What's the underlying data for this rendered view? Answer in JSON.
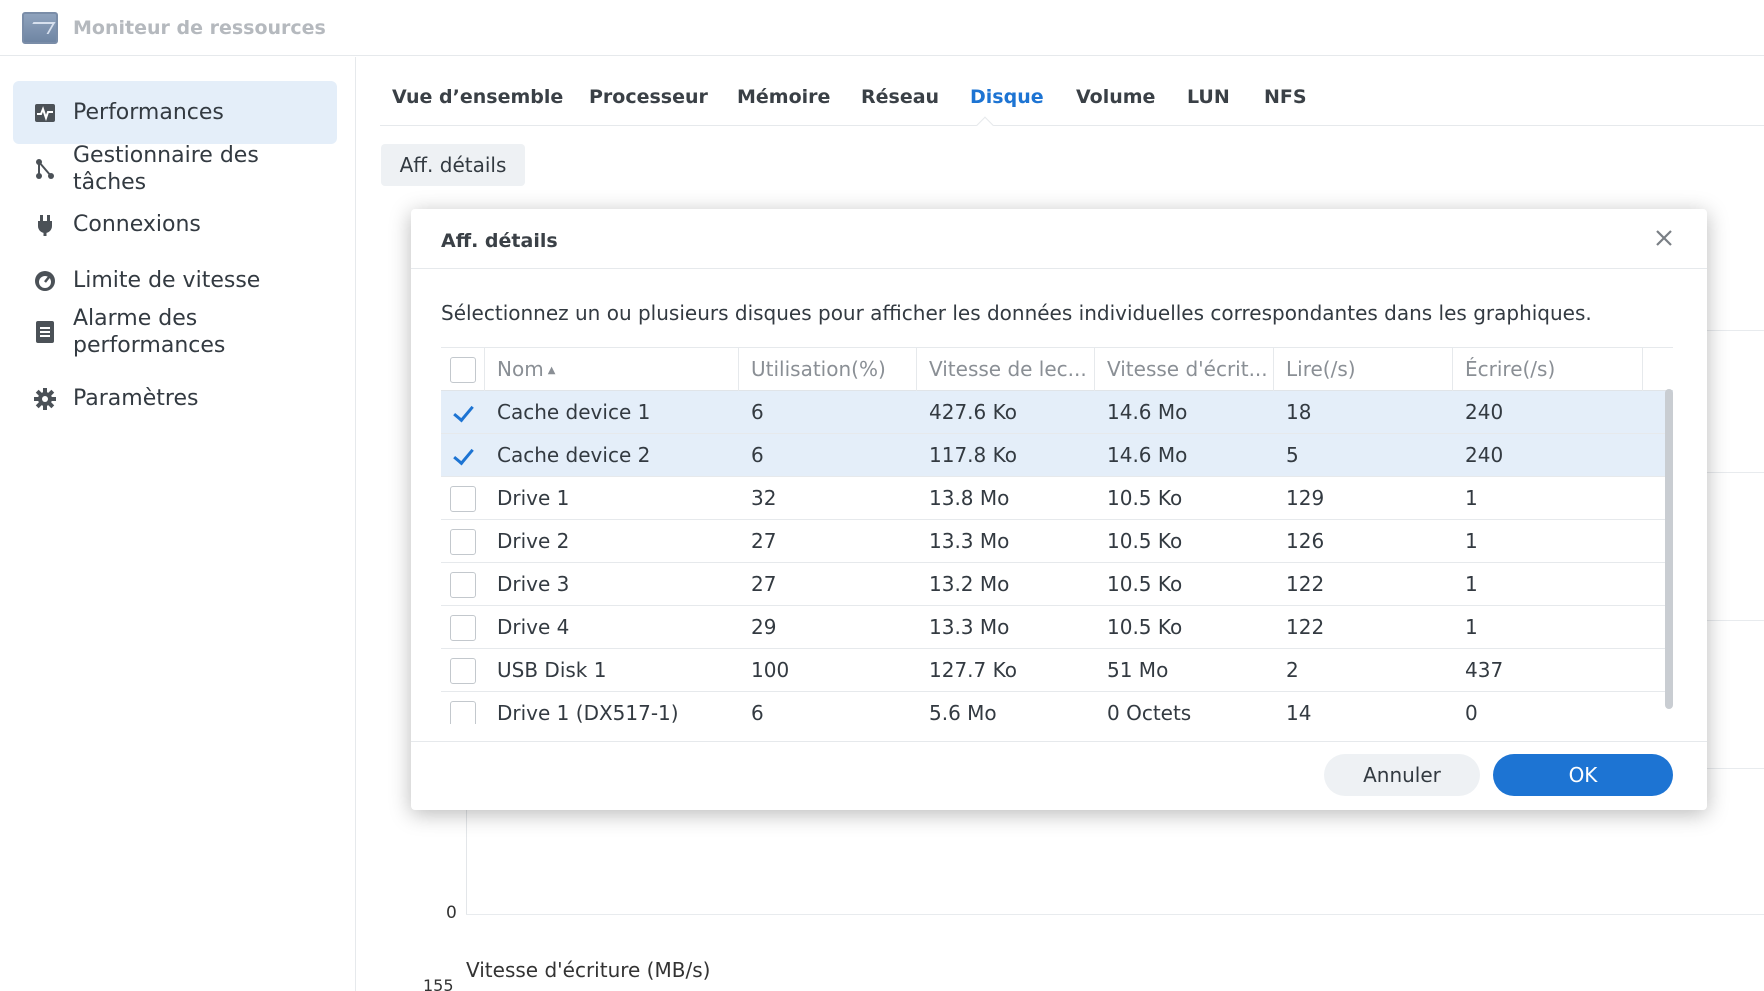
{
  "app": {
    "title": "Moniteur de ressources"
  },
  "sidebar": {
    "items": [
      {
        "label": "Performances",
        "icon": "performance-icon"
      },
      {
        "label": "Gestionnaire des tâches",
        "icon": "task-manager-icon"
      },
      {
        "label": "Connexions",
        "icon": "plug-icon"
      },
      {
        "label": "Limite de vitesse",
        "icon": "speedometer-icon"
      },
      {
        "label": "Alarme des performances",
        "icon": "document-icon"
      },
      {
        "label": "Paramètres",
        "icon": "gear-icon"
      }
    ],
    "active": "Performances"
  },
  "tabs": [
    "Vue d’ensemble",
    "Processeur",
    "Mémoire",
    "Réseau",
    "Disque",
    "Volume",
    "LUN",
    "NFS"
  ],
  "active_tab": "Disque",
  "details_button": "Aff. détails",
  "background": {
    "axis_zero": "0",
    "chart_title": "Vitesse d'écriture (MB/s)",
    "axis_top": "155"
  },
  "dialog": {
    "title": "Aff. détails",
    "description": "Sélectionnez un ou plusieurs disques pour afficher les données individuelles correspondantes dans les graphiques.",
    "columns": [
      "Nom",
      "Utilisation(%)",
      "Vitesse de lec...",
      "Vitesse d'écrit...",
      "Lire(/s)",
      "Écrire(/s)"
    ],
    "rows": [
      {
        "checked": true,
        "name": "Cache device 1",
        "util": "6",
        "read_speed": "427.6 Ko",
        "write_speed": "14.6 Mo",
        "reads": "18",
        "writes": "240"
      },
      {
        "checked": true,
        "name": "Cache device 2",
        "util": "6",
        "read_speed": "117.8 Ko",
        "write_speed": "14.6 Mo",
        "reads": "5",
        "writes": "240"
      },
      {
        "checked": false,
        "name": "Drive 1",
        "util": "32",
        "read_speed": "13.8 Mo",
        "write_speed": "10.5 Ko",
        "reads": "129",
        "writes": "1"
      },
      {
        "checked": false,
        "name": "Drive 2",
        "util": "27",
        "read_speed": "13.3 Mo",
        "write_speed": "10.5 Ko",
        "reads": "126",
        "writes": "1"
      },
      {
        "checked": false,
        "name": "Drive 3",
        "util": "27",
        "read_speed": "13.2 Mo",
        "write_speed": "10.5 Ko",
        "reads": "122",
        "writes": "1"
      },
      {
        "checked": false,
        "name": "Drive 4",
        "util": "29",
        "read_speed": "13.3 Mo",
        "write_speed": "10.5 Ko",
        "reads": "122",
        "writes": "1"
      },
      {
        "checked": false,
        "name": "USB Disk 1",
        "util": "100",
        "read_speed": "127.7 Ko",
        "write_speed": "51 Mo",
        "reads": "2",
        "writes": "437"
      },
      {
        "checked": false,
        "name": "Drive 1 (DX517-1)",
        "util": "6",
        "read_speed": "5.6 Mo",
        "write_speed": "0 Octets",
        "reads": "14",
        "writes": "0"
      }
    ],
    "cancel_label": "Annuler",
    "ok_label": "OK"
  },
  "colors": {
    "accent": "#1d74d3",
    "selected_row": "#e4eef9"
  }
}
